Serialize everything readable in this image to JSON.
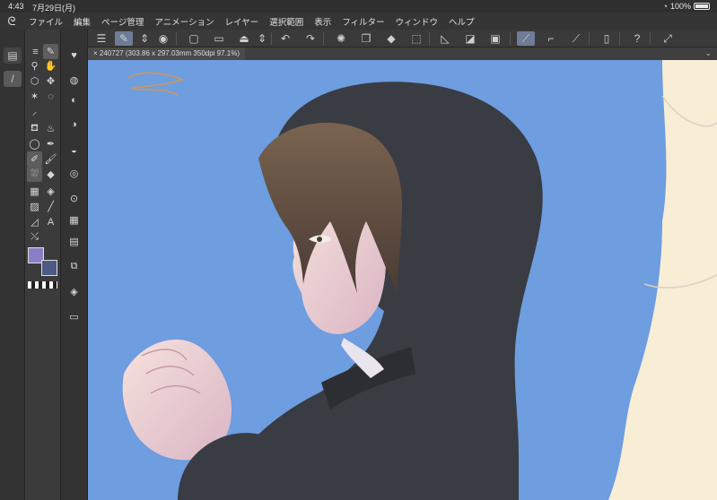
{
  "status": {
    "time": "4:43",
    "date": "7月29日(月)",
    "battery": "100%"
  },
  "menu": {
    "items": [
      "ファイル",
      "編集",
      "ページ管理",
      "アニメーション",
      "レイヤー",
      "選択範囲",
      "表示",
      "フィルター",
      "ウィンドウ",
      "ヘルプ"
    ]
  },
  "canvas": {
    "tab_title": "240727 (303.86 x 297.03mm 350dpi 97.1%)"
  },
  "colors": {
    "main_color": "#8a7fc6",
    "sub_color": "#4e5a86",
    "canvas_bg": "#6e9de0"
  }
}
